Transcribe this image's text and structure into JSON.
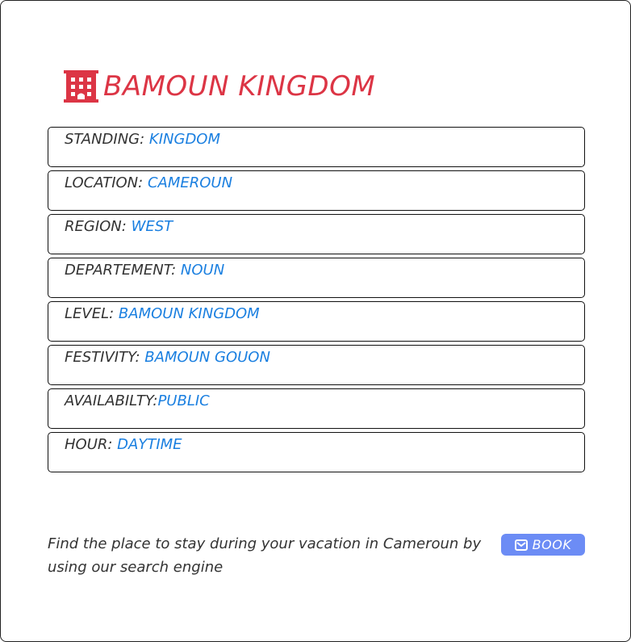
{
  "header": {
    "icon": "building-icon",
    "title": "BAMOUN KINGDOM",
    "title_color": "#dc3545"
  },
  "details": [
    {
      "label": "STANDING: ",
      "value": "KINGDOM"
    },
    {
      "label": "LOCATION: ",
      "value": "CAMEROUN"
    },
    {
      "label": "REGION: ",
      "value": "WEST"
    },
    {
      "label": "DEPARTEMENT: ",
      "value": "NOUN"
    },
    {
      "label": "LEVEL: ",
      "value": "BAMOUN KINGDOM"
    },
    {
      "label": "FESTIVITY: ",
      "value": "BAMOUN GOUON"
    },
    {
      "label": "AVAILABILTY:",
      "value": "PUBLIC"
    },
    {
      "label": "HOUR: ",
      "value": "DAYTIME"
    }
  ],
  "value_color": "#1a7fe0",
  "footer": {
    "text": "Find the place to stay during your vacation in Cameroun by using our search engine",
    "book_button": {
      "icon": "envelope-icon",
      "label": "BOOK",
      "color": "#6c8cf5"
    }
  }
}
